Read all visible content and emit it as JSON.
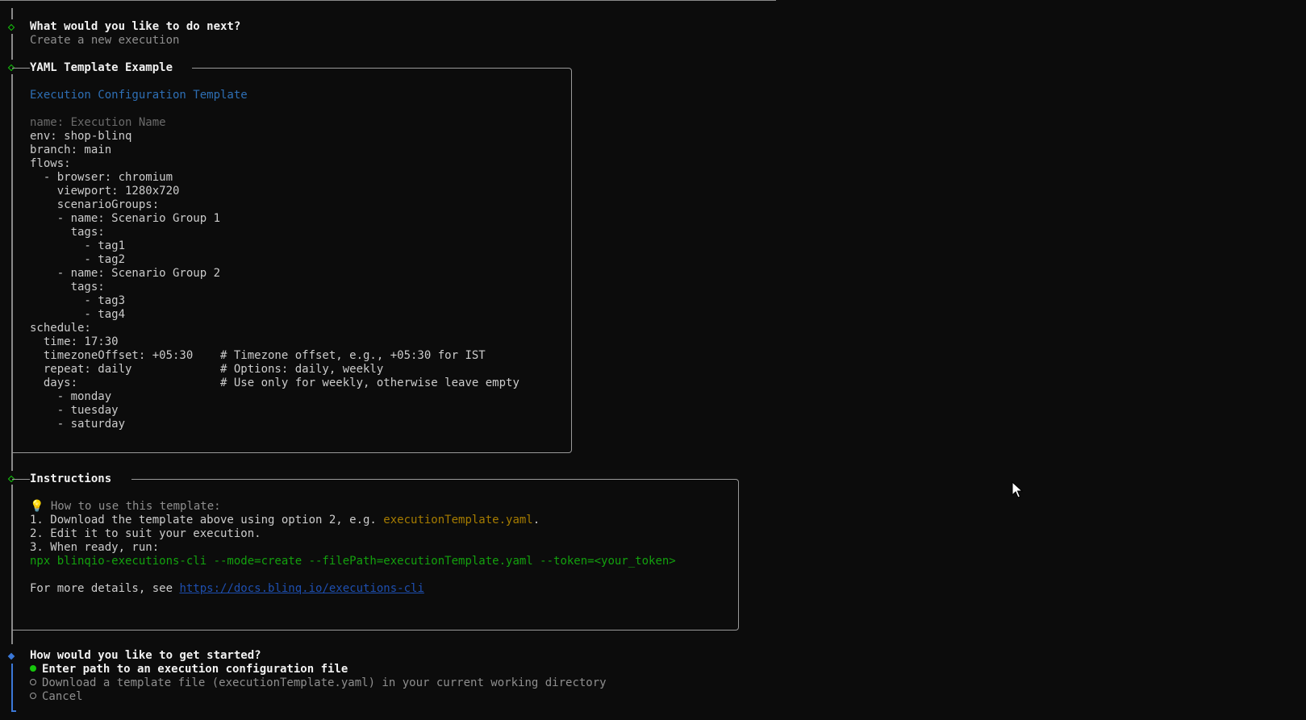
{
  "prompt1": {
    "question": "What would you like to do next?",
    "answer": "Create a new execution"
  },
  "template_box": {
    "title": "YAML Template Example",
    "heading": "Execution Configuration Template",
    "name_line": "name: Execution Name",
    "body": "env: shop-blinq\nbranch: main\nflows:\n  - browser: chromium\n    viewport: 1280x720\n    scenarioGroups:\n    - name: Scenario Group 1\n      tags:\n        - tag1\n        - tag2\n    - name: Scenario Group 2\n      tags:\n        - tag3\n        - tag4\nschedule:\n  time: 17:30\n  timezoneOffset: +05:30    # Timezone offset, e.g., +05:30 for IST\n  repeat: daily             # Options: daily, weekly\n  days:                     # Use only for weekly, otherwise leave empty\n    - monday\n    - tuesday\n    - saturday"
  },
  "instructions_box": {
    "title": "Instructions",
    "tip_icon": "💡",
    "tip": " How to use this template:",
    "step1_prefix": "1. Download the template above using option 2, e.g. ",
    "step1_file": "executionTemplate.yaml",
    "step1_suffix": ".",
    "step2": "2. Edit it to suit your execution.",
    "step3": "3. When ready, run:",
    "command": "npx blinqio-executions-cli --mode=create --filePath=executionTemplate.yaml --token=<your_token>",
    "details_prefix": "For more details, see ",
    "details_link": "https://docs.blinq.io/executions-cli"
  },
  "prompt2": {
    "question": "How would you like to get started?",
    "options": [
      "Enter path to an execution configuration file",
      "Download a template file (executionTemplate.yaml) in your current working directory",
      "Cancel"
    ],
    "selected_index": 0
  },
  "colors": {
    "background": "#0c0c0c",
    "accent_green": "#16c60c",
    "accent_blue": "#3b78d8"
  }
}
